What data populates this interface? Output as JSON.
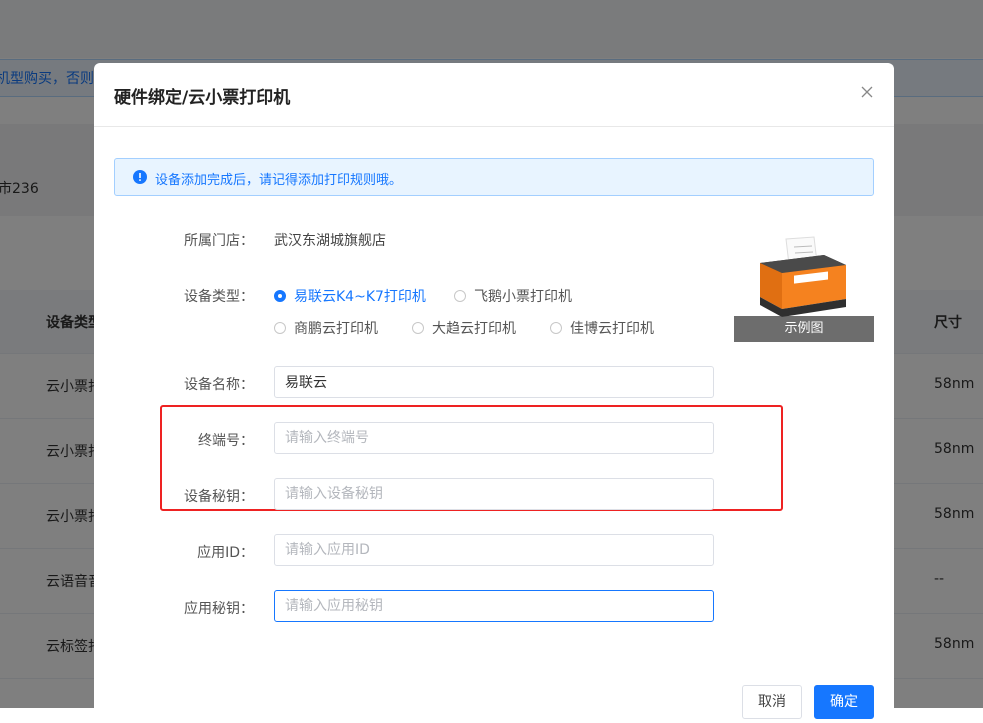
{
  "background": {
    "notice_text": "机型购买，否则",
    "store_id_text": "市236",
    "table": {
      "col_type": "设备类型",
      "col_size": "尺寸",
      "rows": [
        {
          "type": "云小票打",
          "size": "58nm"
        },
        {
          "type": "云小票打",
          "size": "58nm"
        },
        {
          "type": "云小票打",
          "size": "58nm"
        },
        {
          "type": "云语音音",
          "size": "--"
        },
        {
          "type": "云标签打",
          "size": "58nm"
        }
      ]
    }
  },
  "dialog": {
    "title": "硬件绑定/云小票打印机",
    "alert_text": "设备添加完成后，请记得添加打印规则哦。",
    "store_label": "所属门店：",
    "store_value": "武汉东湖城旗舰店",
    "type_label": "设备类型：",
    "type_options": [
      {
        "label": "易联云K4~K7打印机",
        "checked": true
      },
      {
        "label": "飞鹅小票打印机",
        "checked": false
      },
      {
        "label": "商鹏云打印机",
        "checked": false
      },
      {
        "label": "大趋云打印机",
        "checked": false
      },
      {
        "label": "佳博云打印机",
        "checked": false
      }
    ],
    "example_caption": "示例图",
    "name_label": "设备名称：",
    "name_value": "易联云",
    "terminal_label": "终端号：",
    "terminal_placeholder": "请输入终端号",
    "secret_label": "设备秘钥：",
    "secret_placeholder": "请输入设备秘钥",
    "appid_label": "应用ID：",
    "appid_placeholder": "请输入应用ID",
    "appsecret_label": "应用秘钥：",
    "appsecret_placeholder": "请输入应用秘钥",
    "cancel_label": "取消",
    "ok_label": "确定"
  },
  "colors": {
    "primary": "#1677ff",
    "highlight_box": "#ee2222",
    "printer_orange": "#f5821f"
  }
}
